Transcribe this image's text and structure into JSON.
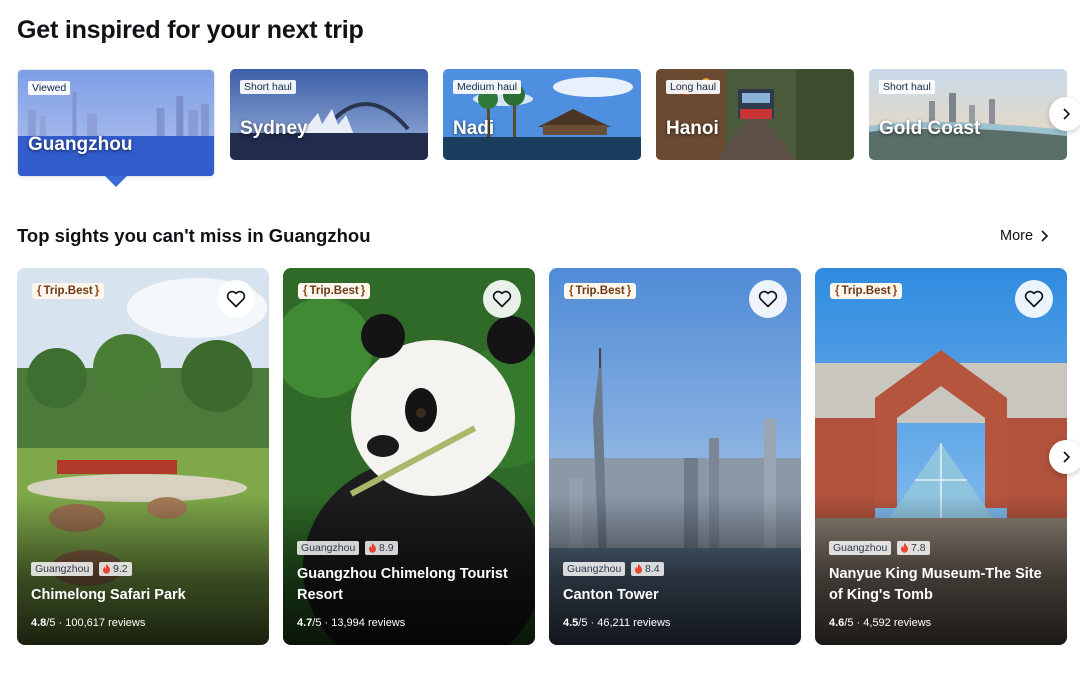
{
  "section1": {
    "title": "Get inspired for your next trip",
    "destinations": [
      {
        "tag": "Viewed",
        "name": "Guangzhou"
      },
      {
        "tag": "Short haul",
        "name": "Sydney"
      },
      {
        "tag": "Medium haul",
        "name": "Nadi"
      },
      {
        "tag": "Long haul",
        "name": "Hanoi"
      },
      {
        "tag": "Short haul",
        "name": "Gold Coast"
      }
    ]
  },
  "section2": {
    "title": "Top sights you can't miss in Guangzhou",
    "more_label": "More",
    "badge_label": "Trip.Best",
    "cards": [
      {
        "city": "Guangzhou",
        "score": "9.2",
        "title": "Chimelong Safari Park",
        "rating": "4.8",
        "rating_suffix": "/5",
        "reviews": "· 100,617 reviews"
      },
      {
        "city": "Guangzhou",
        "score": "8.9",
        "title": "Guangzhou Chimelong Tourist Resort",
        "rating": "4.7",
        "rating_suffix": "/5",
        "reviews": "· 13,994 reviews"
      },
      {
        "city": "Guangzhou",
        "score": "8.4",
        "title": "Canton Tower",
        "rating": "4.5",
        "rating_suffix": "/5",
        "reviews": "· 46,211 reviews"
      },
      {
        "city": "Guangzhou",
        "score": "7.8",
        "title": "Nanyue King Museum-The Site of King's Tomb",
        "rating": "4.6",
        "rating_suffix": "/5",
        "reviews": "· 4,592 reviews"
      }
    ]
  },
  "colors": {
    "accent": "#3a6bd5",
    "heat": "#e8452c",
    "heading": "#0f1115"
  }
}
